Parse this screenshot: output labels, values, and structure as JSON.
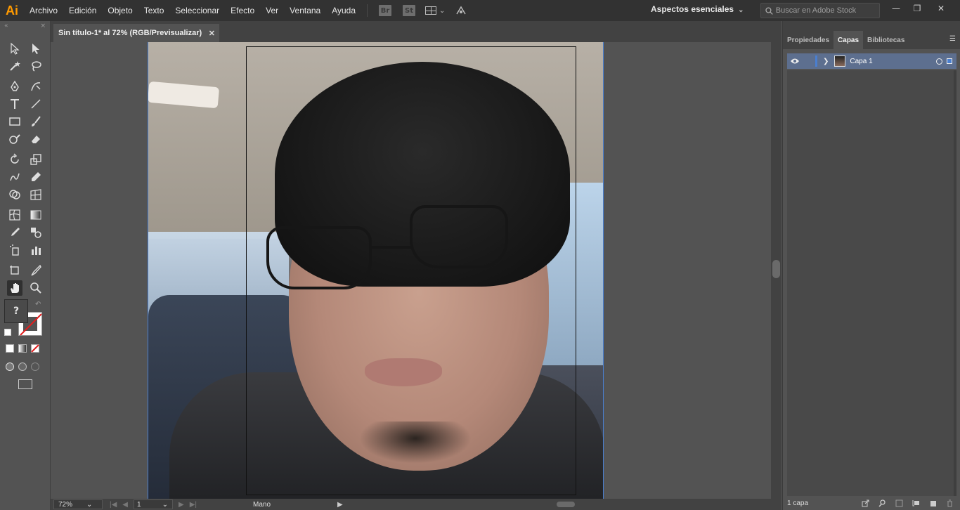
{
  "app": {
    "logo": "Ai"
  },
  "menu": [
    "Archivo",
    "Edición",
    "Objeto",
    "Texto",
    "Seleccionar",
    "Efecto",
    "Ver",
    "Ventana",
    "Ayuda"
  ],
  "app_buttons": {
    "bridge": "Br",
    "stock": "St"
  },
  "workspace": {
    "label": "Aspectos esenciales"
  },
  "search": {
    "placeholder": "Buscar en Adobe Stock"
  },
  "window_controls": {
    "minimize": "—",
    "restore": "❐",
    "close": "✕"
  },
  "document_tab": {
    "title": "Sin título-1* al 72% (RGB/Previsualizar)",
    "close": "✕"
  },
  "toolbar": {
    "fill_label": "?"
  },
  "status": {
    "zoom": "72%",
    "page": "1",
    "tool": "Mano"
  },
  "panel": {
    "tabs": [
      "Propiedades",
      "Capas",
      "Bibliotecas"
    ],
    "active_tab": "Capas",
    "layers": [
      {
        "name": "Capa 1"
      }
    ],
    "footer_count": "1 capa"
  },
  "colors": {
    "accent": "#4a7fd0",
    "logo": "#ff9a00",
    "layer_row": "#5d6f8f"
  }
}
